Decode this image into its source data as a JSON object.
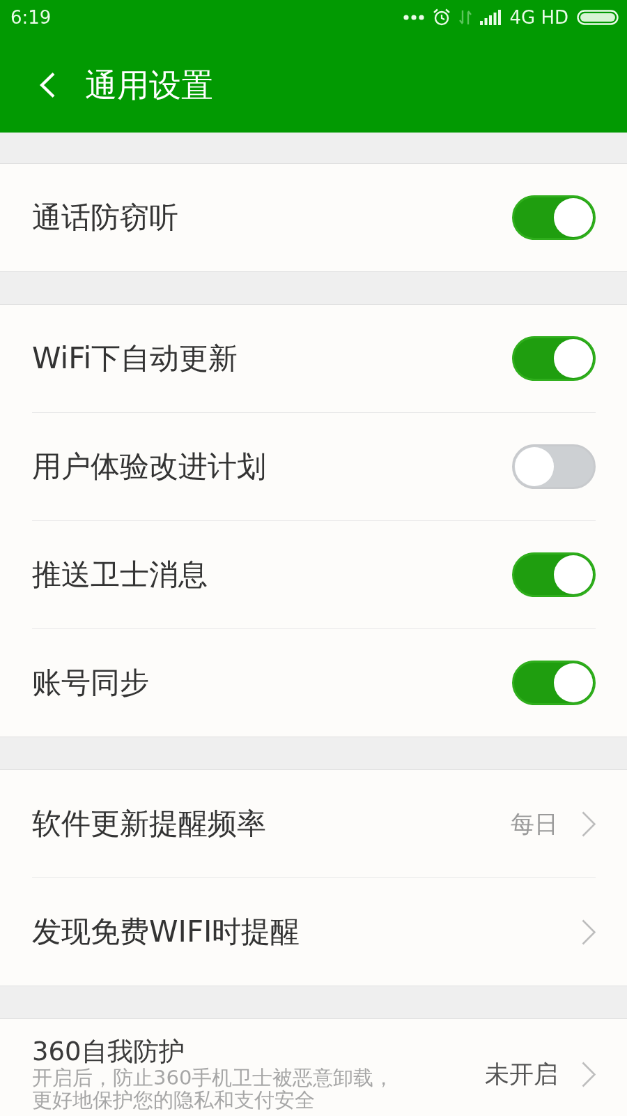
{
  "status_bar": {
    "time": "6:19",
    "network": "4G HD"
  },
  "header": {
    "title": "通用设置"
  },
  "groups": [
    {
      "items": [
        {
          "kind": "toggle",
          "label": "通话防窃听",
          "on": true
        }
      ]
    },
    {
      "items": [
        {
          "kind": "toggle",
          "label": "WiFi下自动更新",
          "on": true
        },
        {
          "kind": "toggle",
          "label": "用户体验改进计划",
          "on": false
        },
        {
          "kind": "toggle",
          "label": "推送卫士消息",
          "on": true
        },
        {
          "kind": "toggle",
          "label": "账号同步",
          "on": true
        }
      ]
    },
    {
      "items": [
        {
          "kind": "link",
          "label": "软件更新提醒频率",
          "value": "每日"
        },
        {
          "kind": "link",
          "label": "发现免费WIFI时提醒"
        }
      ]
    },
    {
      "items": [
        {
          "kind": "detail",
          "label": "360自我防护",
          "description": [
            "开启后，防止360手机卫士被恶意卸载，",
            "更好地保护您的隐私和支付安全"
          ],
          "value": "未开启"
        }
      ]
    }
  ]
}
